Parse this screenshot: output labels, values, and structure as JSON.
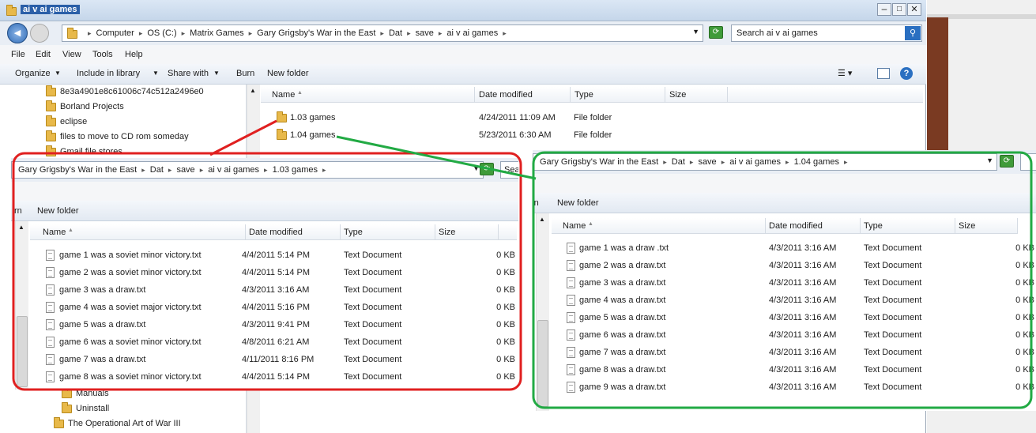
{
  "main": {
    "title": "ai v ai games",
    "back": "◀",
    "breadcrumb": [
      "Computer",
      "OS (C:)",
      "Matrix Games",
      "Gary Grigsby's War in the East",
      "Dat",
      "save",
      "ai v ai games"
    ],
    "search_placeholder": "Search ai v ai games",
    "menu": [
      "File",
      "Edit",
      "View",
      "Tools",
      "Help"
    ],
    "toolbar": [
      "Organize",
      "Include in library",
      "Share with",
      "Burn",
      "New folder"
    ],
    "columns": [
      "Name",
      "Date modified",
      "Type",
      "Size"
    ],
    "rows": [
      {
        "name": "1.03 games",
        "date": "4/24/2011 11:09 AM",
        "type": "File folder",
        "size": ""
      },
      {
        "name": "1.04 games",
        "date": "5/23/2011 6:30 AM",
        "type": "File folder",
        "size": ""
      }
    ],
    "tree": [
      "8e3a4901e8c61006c74c512a2496e0",
      "Borland Projects",
      "eclipse",
      "files to move to CD rom someday",
      "Gmail file stores"
    ],
    "tree_bottom": [
      "Manuals",
      "Uninstall",
      "The Operational Art of War III"
    ]
  },
  "left": {
    "breadcrumb": [
      "Gary Grigsby's War in the East",
      "Dat",
      "save",
      "ai v ai games",
      "1.03 games"
    ],
    "search_stub": "Sea",
    "toolbar": [
      "rn",
      "New folder"
    ],
    "columns": [
      "Name",
      "Date modified",
      "Type",
      "Size"
    ],
    "rows": [
      {
        "name": "game 1 was a soviet minor victory.txt",
        "date": "4/4/2011 5:14 PM",
        "type": "Text Document",
        "size": "0 KB"
      },
      {
        "name": "game 2 was a soviet minor victory.txt",
        "date": "4/4/2011 5:14 PM",
        "type": "Text Document",
        "size": "0 KB"
      },
      {
        "name": "game 3 was a draw.txt",
        "date": "4/3/2011 3:16 AM",
        "type": "Text Document",
        "size": "0 KB"
      },
      {
        "name": "game 4 was a soviet major victory.txt",
        "date": "4/4/2011 5:16 PM",
        "type": "Text Document",
        "size": "0 KB"
      },
      {
        "name": "game 5 was a draw.txt",
        "date": "4/3/2011 9:41 PM",
        "type": "Text Document",
        "size": "0 KB"
      },
      {
        "name": "game 6 was a soviet minor victory.txt",
        "date": "4/8/2011 6:21 AM",
        "type": "Text Document",
        "size": "0 KB"
      },
      {
        "name": "game 7 was a draw.txt",
        "date": "4/11/2011 8:16 PM",
        "type": "Text Document",
        "size": "0 KB"
      },
      {
        "name": "game 8 was a soviet minor victory.txt",
        "date": "4/4/2011 5:14 PM",
        "type": "Text Document",
        "size": "0 KB"
      }
    ]
  },
  "right": {
    "breadcrumb": [
      "Gary Grigsby's War in the East",
      "Dat",
      "save",
      "ai v ai games",
      "1.04 games"
    ],
    "toolbar": [
      "rn",
      "New folder"
    ],
    "columns": [
      "Name",
      "Date modified",
      "Type",
      "Size"
    ],
    "rows": [
      {
        "name": "game 1 was a draw .txt",
        "date": "4/3/2011 3:16 AM",
        "type": "Text Document",
        "size": "0 KB"
      },
      {
        "name": "game 2 was a draw.txt",
        "date": "4/3/2011 3:16 AM",
        "type": "Text Document",
        "size": "0 KB"
      },
      {
        "name": "game 3 was a draw.txt",
        "date": "4/3/2011 3:16 AM",
        "type": "Text Document",
        "size": "0 KB"
      },
      {
        "name": "game 4 was a draw.txt",
        "date": "4/3/2011 3:16 AM",
        "type": "Text Document",
        "size": "0 KB"
      },
      {
        "name": "game 5 was a draw.txt",
        "date": "4/3/2011 3:16 AM",
        "type": "Text Document",
        "size": "0 KB"
      },
      {
        "name": "game 6 was a draw.txt",
        "date": "4/3/2011 3:16 AM",
        "type": "Text Document",
        "size": "0 KB"
      },
      {
        "name": "game 7 was a draw.txt",
        "date": "4/3/2011 3:16 AM",
        "type": "Text Document",
        "size": "0 KB"
      },
      {
        "name": "game 8 was a draw.txt",
        "date": "4/3/2011 3:16 AM",
        "type": "Text Document",
        "size": "0 KB"
      },
      {
        "name": "game 9 was a draw.txt",
        "date": "4/3/2011 3:16 AM",
        "type": "Text Document",
        "size": "0 KB"
      }
    ]
  },
  "colors": {
    "red_outline": "#e02020",
    "green_outline": "#22aa44",
    "title_bar": "#c9d9ec"
  }
}
